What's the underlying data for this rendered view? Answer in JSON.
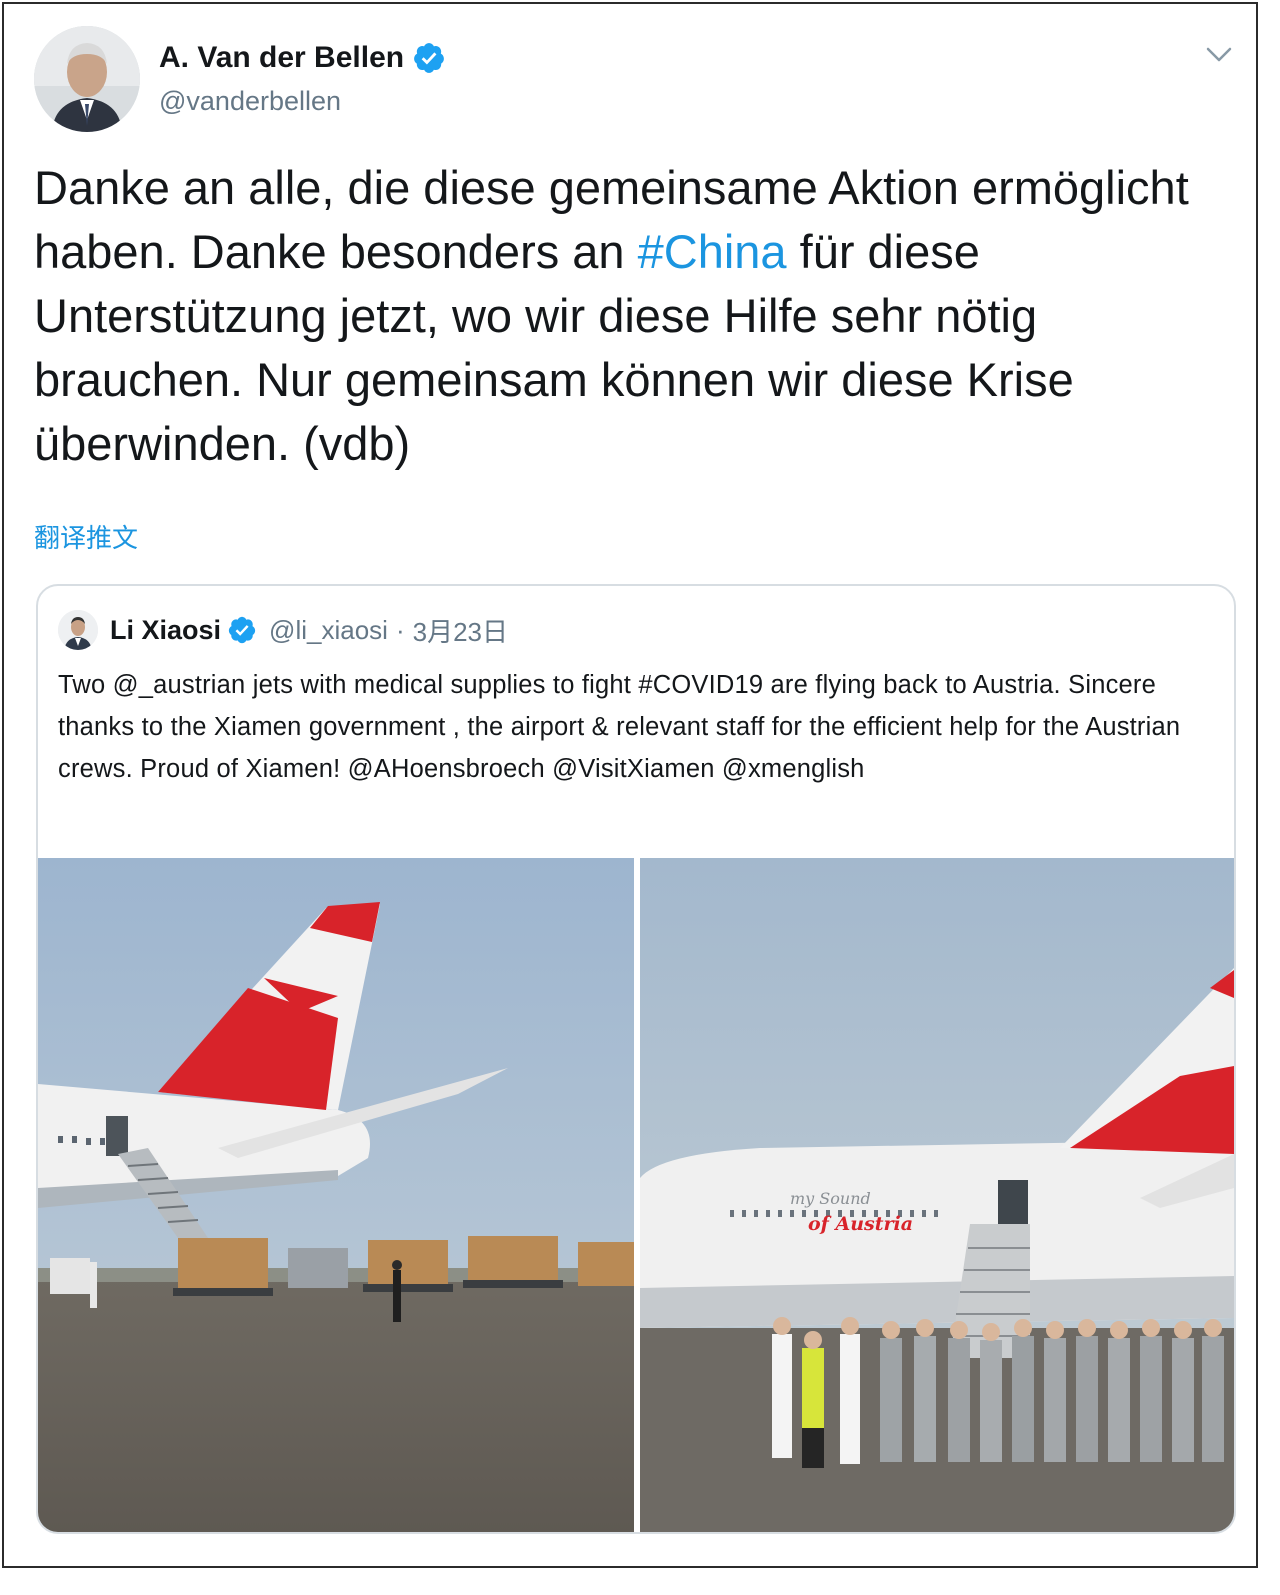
{
  "tweet": {
    "display_name": "A. Van der Bellen",
    "handle": "@vanderbellen",
    "text_part1": "Danke an alle, die diese gemeinsame Aktion ermöglicht haben. Danke besonders an ",
    "hashtag": "#China",
    "text_part2": " für diese Unterstützung jetzt, wo wir diese Hilfe sehr nötig brauchen. Nur gemeinsam können wir diese Krise überwinden. (vdb)",
    "translate_label": "翻译推文"
  },
  "quoted": {
    "display_name": "Li Xiaosi",
    "handle": "@li_xiaosi",
    "separator": "·",
    "date": "3月23日",
    "text": "Two @_austrian jets with medical supplies to fight #COVID19 are flying back to Austria. Sincere thanks to the Xiamen government , the airport & relevant staff for the efficient help for the Austrian crews. Proud of Xiamen! @AHoensbroech @VisitXiamen @xmenglish",
    "photo_right_fuselage_line1": "my Sound",
    "photo_right_fuselage_line2": "of Austria"
  },
  "icons": {
    "verified": "verified-badge-icon",
    "caret": "chevron-down-icon"
  },
  "colors": {
    "link": "#1b95e0",
    "verified": "#1da1f2",
    "secondary_text": "#657786",
    "austrian_red": "#d8232a"
  }
}
